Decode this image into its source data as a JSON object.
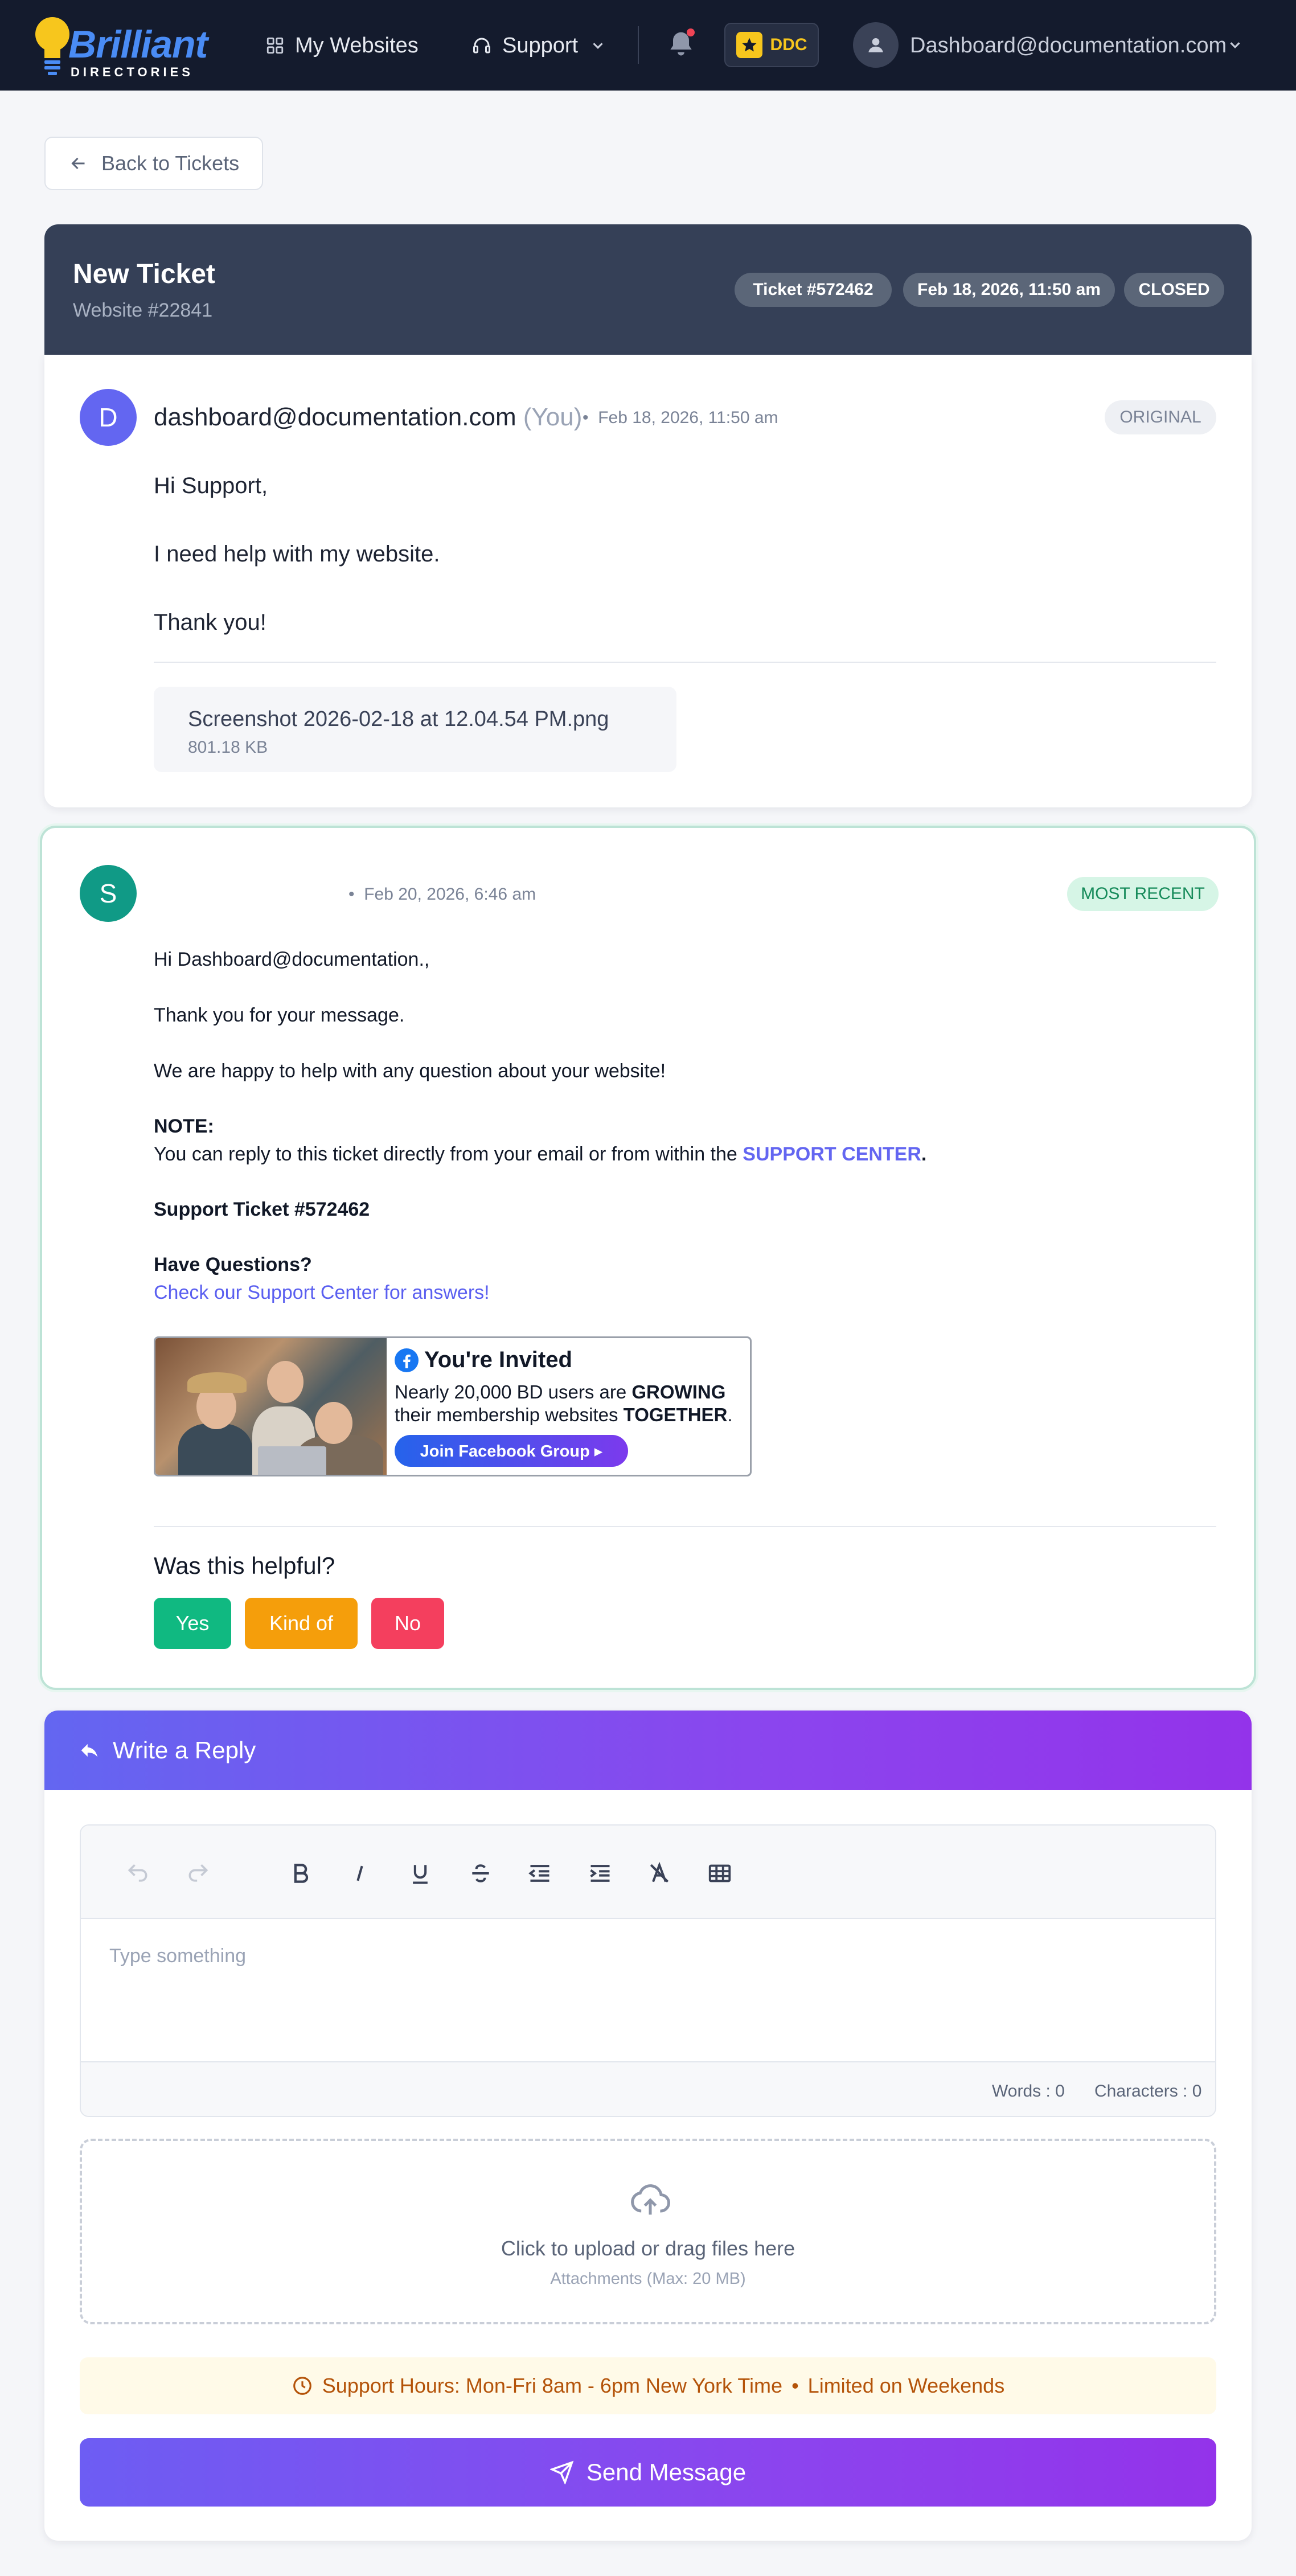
{
  "nav": {
    "brand_main": "Brilliant",
    "brand_sub": "DIRECTORIES",
    "my_websites": "My Websites",
    "support": "Support",
    "ddc_label": "DDC",
    "user_email": "Dashboard@documentation.com",
    "notification_dot_color": "#ef4455"
  },
  "back_button": {
    "label": "Back to Tickets"
  },
  "ticket": {
    "title": "New Ticket",
    "website": "Website #22841",
    "number_pill": "Ticket #572462",
    "date_pill": "Feb 18, 2026, 11:50 am",
    "status_pill": "CLOSED"
  },
  "original_message": {
    "avatar_letter": "D",
    "sender": "dashboard@documentation.com",
    "you_tag": "(You)",
    "bullet": "•",
    "timestamp": "Feb 18, 2026, 11:50 am",
    "badge": "ORIGINAL",
    "lines": [
      "Hi Support,",
      "I need help with my website.",
      "Thank you!"
    ],
    "attachment": {
      "name": "Screenshot 2026-02-18 at 12.04.54 PM.png",
      "size": "801.18 KB"
    }
  },
  "recent_message": {
    "avatar_letter": "S",
    "bullet": "•",
    "timestamp": "Feb 20, 2026, 6:46 am",
    "badge": "MOST RECENT",
    "greeting": "Hi Dashboard@documentation.,",
    "line1": "Thank you for your message.",
    "line2": "We are happy to help with any question about your website!",
    "note_label": "NOTE:",
    "note_text": "You can reply to this ticket directly from your email or from within the",
    "note_link": "SUPPORT CENTER",
    "note_end": ".",
    "ticket_ref": "Support Ticket #572462",
    "questions_label": "Have Questions?",
    "questions_link": "Check our Support Center for answers!",
    "banner": {
      "title": "You're Invited",
      "line1_pre": "Nearly 20,000 BD users are ",
      "line1_bold": "GROWING",
      "line2_pre": "their membership websites ",
      "line2_bold": "TOGETHER",
      "line2_end": ".",
      "button": "Join Facebook Group ▸"
    },
    "helpful_question": "Was this helpful?",
    "vote_yes": "Yes",
    "vote_kind": "Kind of",
    "vote_no": "No"
  },
  "reply": {
    "header": "Write a Reply",
    "toolbar": [
      "undo-icon",
      "redo-icon",
      "bold-icon",
      "italic-icon",
      "underline-icon",
      "strikethrough-icon",
      "outdent-icon",
      "indent-icon",
      "clear-format-icon",
      "table-icon"
    ],
    "placeholder": "Type something",
    "words": "Words : 0",
    "characters": "Characters : 0",
    "upload_main": "Click to upload or drag files here",
    "upload_sub": "Attachments (Max: 20 MB)",
    "hours_text": "Support Hours: Mon-Fri 8am - 6pm New York Time",
    "hours_sep": "•",
    "hours_extra": "Limited on Weekends",
    "send": "Send Message"
  },
  "colors": {
    "nav_bg": "#141b2d",
    "ticket_header_bg": "#354057",
    "accent_purple": "#6366f1",
    "yes_green": "#10b981",
    "kind_orange": "#f59e0b",
    "no_red": "#f43f5e",
    "recent_border": "#bde3d6"
  }
}
